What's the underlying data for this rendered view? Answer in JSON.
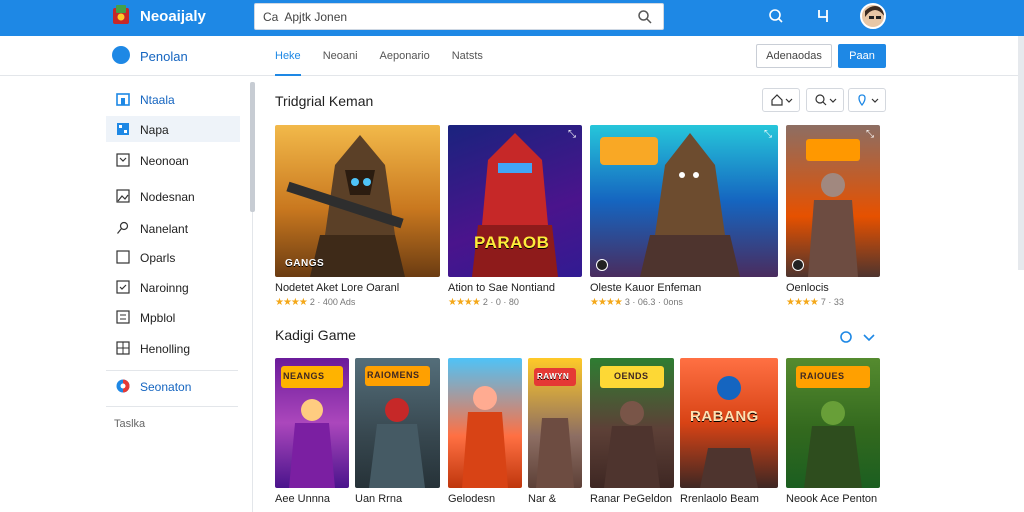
{
  "app": {
    "title": "Neoaijaly"
  },
  "search": {
    "value": "Ca  Apjtk Jonen"
  },
  "nav": {
    "brand": "Penolan",
    "tabs": [
      "Heke",
      "Neoani",
      "Aeponario",
      "Natsts"
    ],
    "outline_button": "Adenaodas",
    "primary_button": "Paan"
  },
  "sidebar": {
    "items": [
      {
        "label": "Ntaala",
        "icon": "home-icon"
      },
      {
        "label": "Napa",
        "icon": "grid-icon"
      },
      {
        "label": "Neonoan",
        "icon": "chevron-box-icon"
      },
      {
        "label": "Nodesnan",
        "icon": "image-icon"
      },
      {
        "label": "Nanelant",
        "icon": "pin-icon"
      },
      {
        "label": "Oparls",
        "icon": "square-icon"
      },
      {
        "label": "Naroinng",
        "icon": "check-box-icon"
      },
      {
        "label": "Mpblol",
        "icon": "list-box-icon"
      },
      {
        "label": "Henolling",
        "icon": "table-icon"
      },
      {
        "label": "Seonaton",
        "icon": "globe-icon"
      }
    ],
    "footer": "Taslka"
  },
  "trending": {
    "title": "Tridgrial Keman",
    "cards": [
      {
        "title": "Nodetet Aket Lore Oaranl",
        "meta": "2 · 400 Ads",
        "badge": "GANGS"
      },
      {
        "title": "Ation to Sae Nontiand",
        "meta": "2 · 0 · 80",
        "badge": "PARAOB"
      },
      {
        "title": "Oleste Kauor Enfeman",
        "meta": "3 · 06.3 · 0ons",
        "badge": ""
      },
      {
        "title": "Oenlocis",
        "meta": "7 · 33",
        "badge": ""
      }
    ]
  },
  "featured": {
    "title": "Kadigi Game",
    "cards": [
      {
        "title": "Aee Unnna",
        "badge": "NEANGS"
      },
      {
        "title": "Uan Rrna",
        "badge": "RAIOMENS"
      },
      {
        "title": "Gelodesn",
        "badge": ""
      },
      {
        "title": "Nar &",
        "badge": "RAWYN"
      },
      {
        "title": "Ranar PeGeldon",
        "badge": "OENDS"
      },
      {
        "title": "Rrenlaolo Beam",
        "badge": "RABANG"
      },
      {
        "title": "Neook Ace Penton",
        "badge": "RAIOUES"
      }
    ]
  },
  "colors": {
    "accent": "#1e88e5",
    "star": "#f4a81a"
  }
}
